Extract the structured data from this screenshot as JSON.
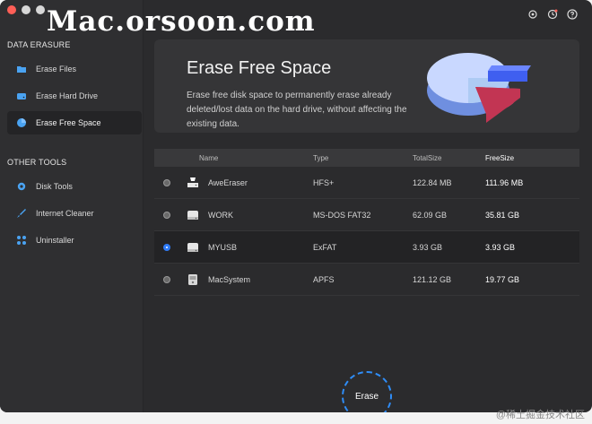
{
  "app": {
    "watermark": "Mac.orsoon.com"
  },
  "sidebar": {
    "section_data_erasure": "DATA ERASURE",
    "data_items": [
      {
        "label": "Erase Files",
        "icon": "folder-icon"
      },
      {
        "label": "Erase Hard Drive",
        "icon": "hard-drive-icon"
      },
      {
        "label": "Erase Free Space",
        "icon": "pie-chart-icon"
      }
    ],
    "section_other_tools": "OTHER TOOLS",
    "tool_items": [
      {
        "label": "Disk Tools",
        "icon": "gear-icon"
      },
      {
        "label": "Internet Cleaner",
        "icon": "rocket-icon"
      },
      {
        "label": "Uninstaller",
        "icon": "apps-icon"
      }
    ]
  },
  "header_icons": [
    "settings-icon",
    "history-icon",
    "help-icon"
  ],
  "hero": {
    "title": "Erase Free Space",
    "description": "Erase free disk space to permanently erase already deleted/lost data on the hard drive, without affecting the existing data."
  },
  "table": {
    "headers": {
      "name": "Name",
      "type": "Type",
      "total": "TotalSize",
      "free": "FreeSize"
    },
    "rows": [
      {
        "name": "AweEraser",
        "type": "HFS+",
        "total": "122.84 MB",
        "free": "111.96 MB",
        "selected": false,
        "icon": "system-drive-icon"
      },
      {
        "name": "WORK",
        "type": "MS-DOS FAT32",
        "total": "62.09 GB",
        "free": "35.81 GB",
        "selected": false,
        "icon": "drive-icon"
      },
      {
        "name": "MYUSB",
        "type": "ExFAT",
        "total": "3.93 GB",
        "free": "3.93 GB",
        "selected": true,
        "icon": "drive-icon"
      },
      {
        "name": "MacSystem",
        "type": "APFS",
        "total": "121.12 GB",
        "free": "19.77 GB",
        "selected": false,
        "icon": "internal-drive-icon"
      }
    ]
  },
  "erase_button": "Erase",
  "bottom_watermark": "@稀土掘金技术社区",
  "colors": {
    "accent": "#2f7bf6",
    "hero_red": "#e84a6a",
    "hero_blue": "#3f5ff0"
  }
}
